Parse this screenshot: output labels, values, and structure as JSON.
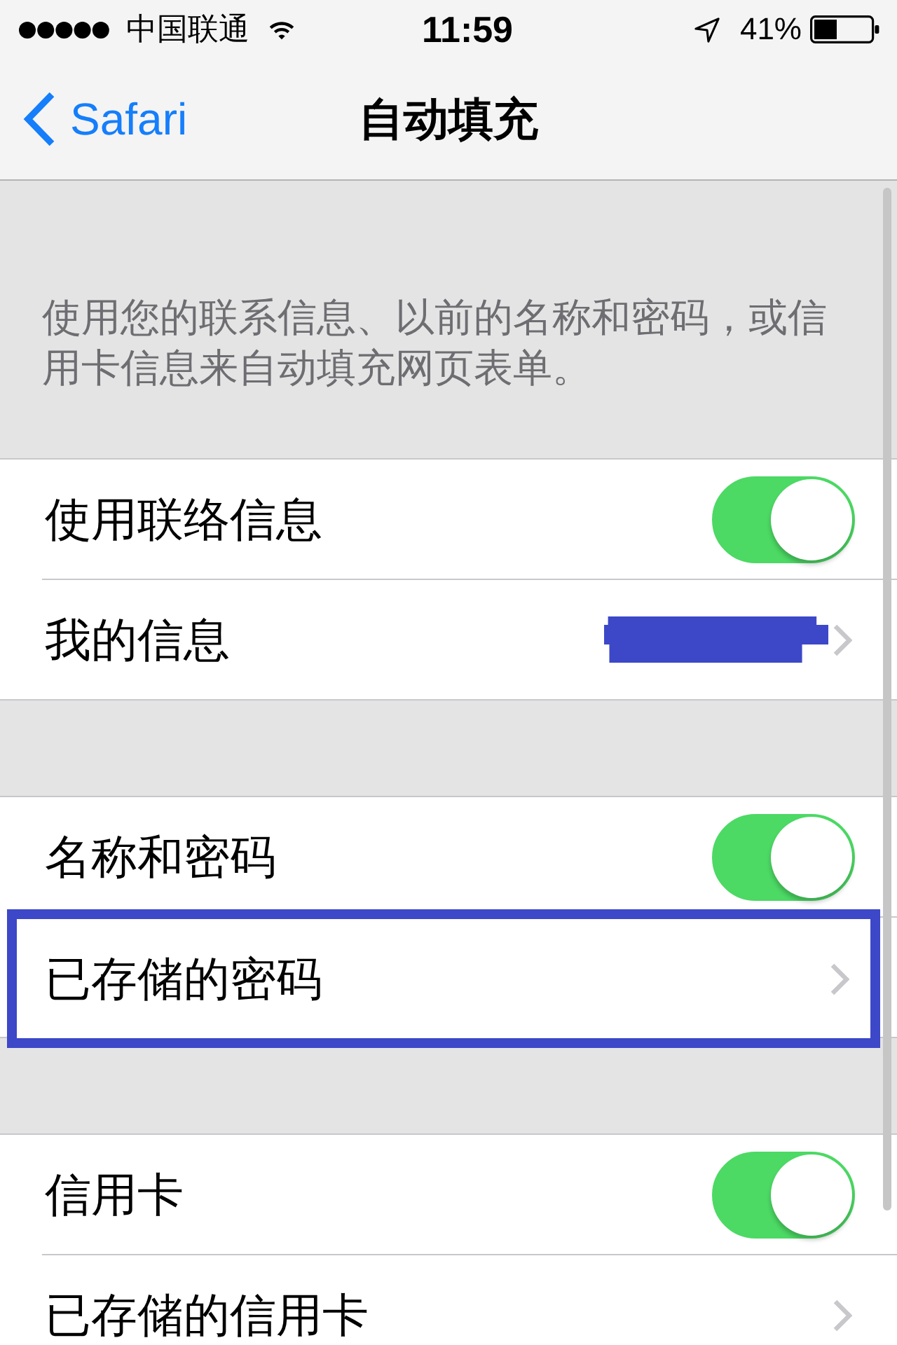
{
  "status_bar": {
    "carrier": "中国联通",
    "time": "11:59",
    "battery": "41%"
  },
  "nav_bar": {
    "back": "Safari",
    "title": "自动填充"
  },
  "description": "使用您的联系信息、以前的名称和密码，或信用卡信息来自动填充网页表单。",
  "groups": [
    {
      "rows": [
        {
          "kind": "toggle",
          "label": "使用联络信息",
          "on": true
        },
        {
          "kind": "link",
          "label": "我的信息",
          "redacted": true,
          "highlighted": false
        }
      ]
    },
    {
      "rows": [
        {
          "kind": "toggle",
          "label": "名称和密码",
          "on": true
        },
        {
          "kind": "link",
          "label": "已存储的密码",
          "redacted": false,
          "highlighted": true
        }
      ]
    },
    {
      "rows": [
        {
          "kind": "toggle",
          "label": "信用卡",
          "on": true
        },
        {
          "kind": "link",
          "label": "已存储的信用卡",
          "redacted": false,
          "highlighted": false
        }
      ]
    }
  ]
}
